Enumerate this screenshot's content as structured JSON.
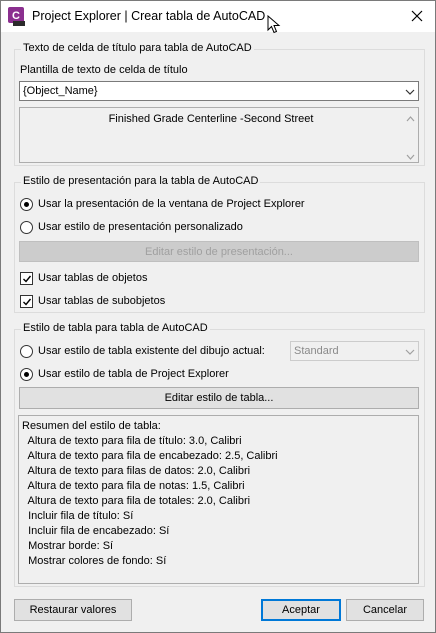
{
  "window": {
    "title": "Project Explorer | Crear tabla de AutoCAD",
    "app_icon_letter": "C"
  },
  "title_cell_group": {
    "legend": "Texto de celda de título para tabla de AutoCAD",
    "template_label": "Plantilla de texto de celda de título",
    "template_value": "{Object_Name}",
    "preview_text": "Finished Grade Centerline -Second Street"
  },
  "presentation_group": {
    "legend": "Estilo de presentación para la tabla de AutoCAD",
    "radio_window": {
      "label": "Usar la presentación de la ventana de Project Explorer",
      "checked": true
    },
    "radio_custom": {
      "label": "Usar estilo de presentación personalizado",
      "checked": false
    },
    "edit_button": "Editar estilo de presentación...",
    "check_object_tables": {
      "label": "Usar tablas de objetos",
      "checked": true
    },
    "check_subobject_tables": {
      "label": "Usar tablas de subobjetos",
      "checked": true
    }
  },
  "table_style_group": {
    "legend": "Estilo de tabla para tabla de AutoCAD",
    "radio_existing": {
      "label": "Usar estilo de tabla existente del dibujo actual:",
      "checked": false
    },
    "existing_style_value": "Standard",
    "radio_project": {
      "label": "Usar estilo de tabla de Project Explorer",
      "checked": true
    },
    "edit_button": "Editar estilo de tabla...",
    "summary_lines": [
      "Resumen del estilo de tabla:",
      "  Altura de texto para fila de título: 3.0, Calibri",
      "  Altura de texto para fila de encabezado: 2.5, Calibri",
      "  Altura de texto para filas de datos: 2.0, Calibri",
      "  Altura de texto para fila de notas: 1.5, Calibri",
      "  Altura de texto para fila de totales: 2.0, Calibri",
      "  Incluir fila de título: Sí",
      "  Incluir fila de encabezado: Sí",
      "  Mostrar borde: Sí",
      "  Mostrar colores de fondo: Sí"
    ]
  },
  "footer": {
    "restore_button": "Restaurar valores",
    "accept_button": "Aceptar",
    "cancel_button": "Cancelar"
  },
  "colors": {
    "app_icon": "#8b2f8f",
    "accent": "#0078d7"
  }
}
